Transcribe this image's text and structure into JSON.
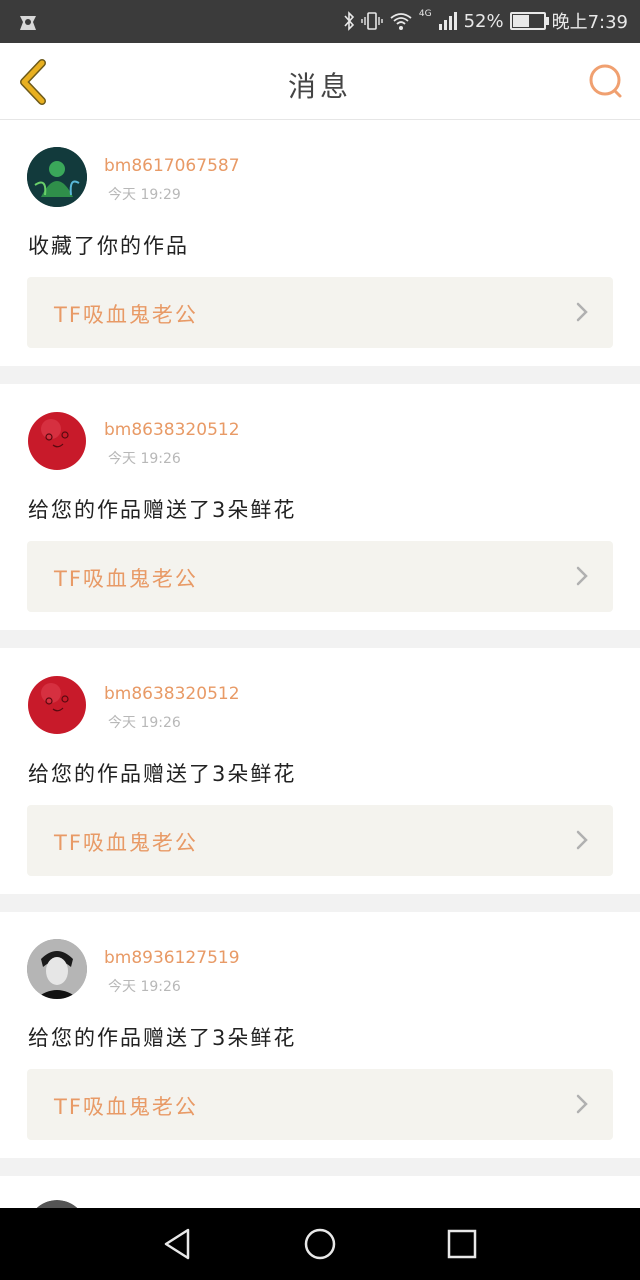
{
  "status_bar": {
    "network": "4G",
    "battery": "52%",
    "battery_level": 0.52,
    "time": "晚上7:39"
  },
  "header": {
    "title": "消息"
  },
  "messages": [
    {
      "username": "bm8617067587",
      "time": "今天 19:29",
      "action": "收藏了你的作品",
      "work_title": "TF吸血鬼老公",
      "avatar": "dark-green-warrior"
    },
    {
      "username": "bm8638320512",
      "time": "今天 19:26",
      "action": "给您的作品赠送了3朵鲜花",
      "work_title": "TF吸血鬼老公",
      "avatar": "red-ball-face"
    },
    {
      "username": "bm8638320512",
      "time": "今天 19:26",
      "action": "给您的作品赠送了3朵鲜花",
      "work_title": "TF吸血鬼老公",
      "avatar": "red-ball-face"
    },
    {
      "username": "bm8936127519",
      "time": "今天 19:26",
      "action": "给您的作品赠送了3朵鲜花",
      "work_title": "TF吸血鬼老公",
      "avatar": "bw-portrait"
    }
  ],
  "colors": {
    "accent": "#e89a66",
    "back_arrow": "#e8b020",
    "work_bg": "#f4f3ee"
  }
}
